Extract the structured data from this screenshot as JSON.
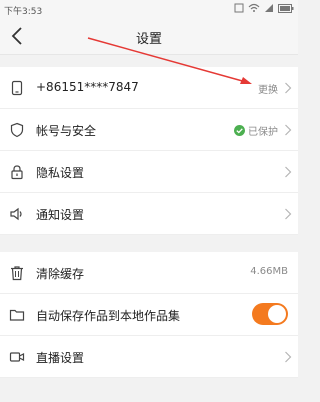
{
  "status_bar": {
    "time": "下午3:53"
  },
  "header": {
    "title": "设置"
  },
  "groups": [
    {
      "items": [
        {
          "icon": "phone-icon",
          "label": "+86151****7847",
          "value": "更换"
        },
        {
          "icon": "shield-icon",
          "label": "帐号与安全",
          "value": "已保护"
        },
        {
          "icon": "lock-icon",
          "label": "隐私设置",
          "value": ""
        },
        {
          "icon": "speaker-icon",
          "label": "通知设置",
          "value": ""
        }
      ]
    },
    {
      "items": [
        {
          "icon": "trash-icon",
          "label": "清除缓存",
          "value": "4.66MB"
        },
        {
          "icon": "folder-icon",
          "label": "自动保存作品到本地作品集",
          "toggle": true
        },
        {
          "icon": "video-camera-icon",
          "label": "直播设置",
          "value": ""
        }
      ]
    }
  ],
  "colors": {
    "accent": "#f47a1f",
    "protected_badge": "#4caf50",
    "annotation_arrow": "#e53935"
  }
}
